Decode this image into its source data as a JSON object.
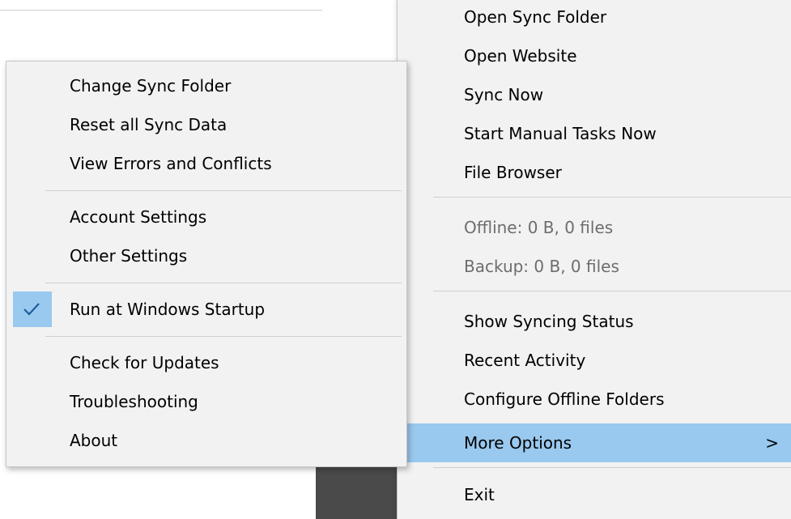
{
  "main_menu": {
    "items": [
      {
        "label": "Open Sync Folder"
      },
      {
        "label": "Open Website"
      },
      {
        "label": "Sync Now"
      },
      {
        "label": "Start Manual Tasks Now"
      },
      {
        "label": "File Browser"
      },
      {
        "label": "Offline: 0 B, 0 files"
      },
      {
        "label": "Backup: 0 B, 0 files"
      },
      {
        "label": "Show Syncing Status"
      },
      {
        "label": "Recent Activity"
      },
      {
        "label": "Configure Offline Folders"
      },
      {
        "label": "More Options",
        "submenu_arrow": ">"
      },
      {
        "label": "Exit"
      }
    ]
  },
  "sub_menu": {
    "items": [
      {
        "label": "Change Sync Folder"
      },
      {
        "label": "Reset all Sync Data"
      },
      {
        "label": "View Errors and Conflicts"
      },
      {
        "label": "Account Settings"
      },
      {
        "label": "Other Settings"
      },
      {
        "label": "Run at Windows Startup",
        "checked": true
      },
      {
        "label": "Check for Updates"
      },
      {
        "label": "Troubleshooting"
      },
      {
        "label": "About"
      }
    ]
  },
  "taskbar": {
    "tray_icon": "speaker-icon"
  },
  "colors": {
    "menu_bg": "#f2f2f2",
    "highlight": "#99c9ef",
    "disabled_text": "#6d6d6d",
    "taskbar": "#4a4a4a"
  }
}
